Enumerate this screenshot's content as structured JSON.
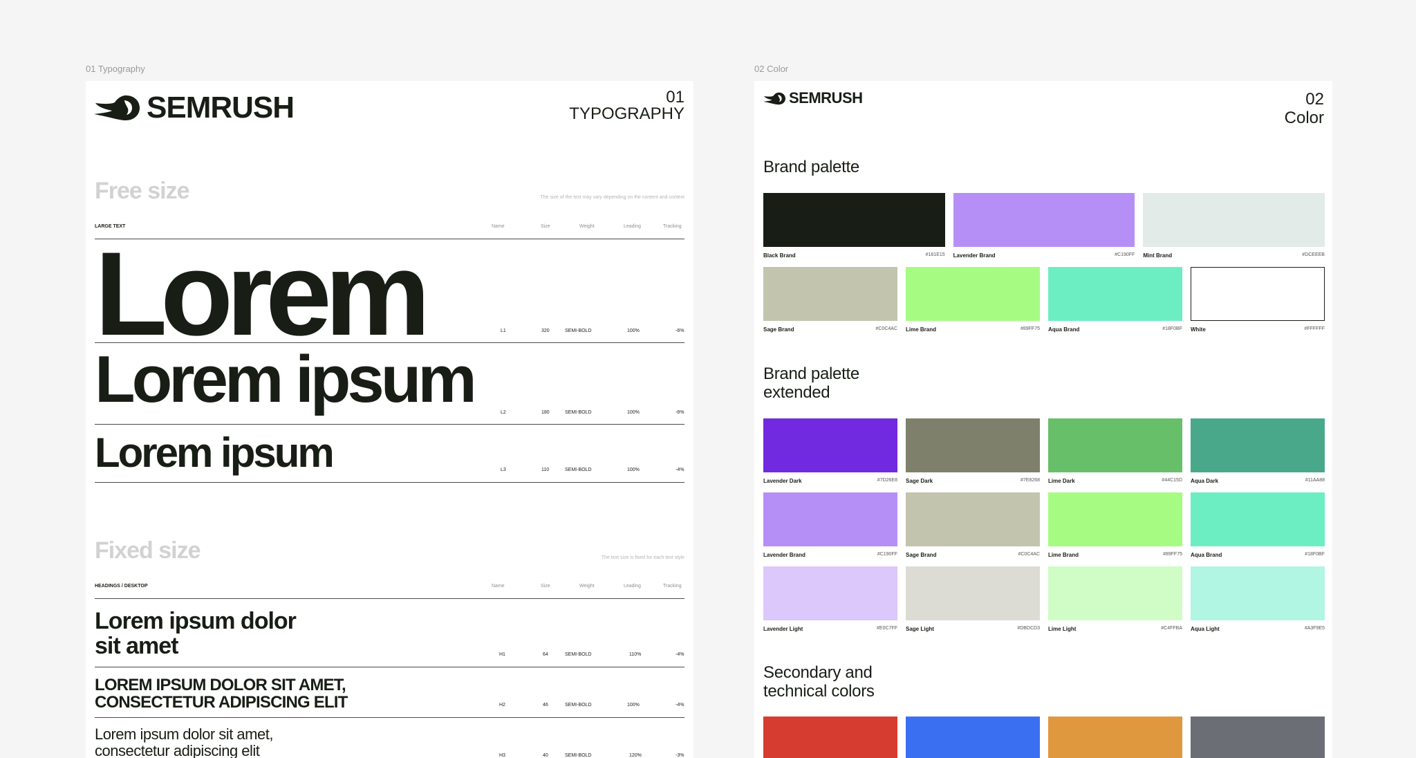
{
  "frames": {
    "typography_label": "01 Typography",
    "color_label": "02 Color"
  },
  "typography": {
    "brand": "SEMRUSH",
    "number": "01",
    "title": "TYPOGRAPHY",
    "columns": {
      "name": "Name",
      "size": "Size",
      "weight": "Weight",
      "leading": "Leading",
      "tracking": "Tracking"
    },
    "free": {
      "title": "Free size",
      "note": "The size of the text may vary depending on the content and context",
      "category": "LARGE TEXT",
      "rows": [
        {
          "sample": "Lorem",
          "name": "L1",
          "size": "320",
          "weight": "SEMI-BOLD",
          "leading": "100%",
          "tracking": "-6%"
        },
        {
          "sample": "Lorem ipsum",
          "name": "L2",
          "size": "180",
          "weight": "SEMI-BOLD",
          "leading": "100%",
          "tracking": "-6%"
        },
        {
          "sample": "Lorem ipsum",
          "name": "L3",
          "size": "110",
          "weight": "SEMI-BOLD",
          "leading": "100%",
          "tracking": "-4%"
        }
      ]
    },
    "fixed": {
      "title": "Fixed size",
      "note": "The text size is fixed for each text style",
      "category": "HEADINGS / DESKTOP",
      "rows": [
        {
          "line1": "Lorem ipsum dolor",
          "line2": "sit amet",
          "name": "H1",
          "size": "64",
          "weight": "SEMI-BOLD",
          "leading": "110%",
          "tracking": "-4%"
        },
        {
          "line1": "LOREM IPSUM DOLOR SIT AMET,",
          "line2": "CONSECTETUR ADIPISCING ELIT",
          "name": "H2",
          "size": "46",
          "weight": "SEMI-BOLD",
          "leading": "100%",
          "tracking": "-4%"
        },
        {
          "line1": "Lorem ipsum dolor sit amet,",
          "line2": "consectetur adipiscing elit",
          "name": "H3",
          "size": "40",
          "weight": "SEMI-BOLD",
          "leading": "120%",
          "tracking": "-3%"
        }
      ]
    }
  },
  "color": {
    "brand": "SEMRUSH",
    "number": "02",
    "title": "Color",
    "brand_palette_title": "Brand palette",
    "brand_palette_row1": [
      {
        "name": "Black Brand",
        "hex": "#181E15"
      },
      {
        "name": "Lavender Brand",
        "hex": "#C190FF"
      },
      {
        "name": "Mint Brand",
        "hex": "#DCEEEB"
      }
    ],
    "brand_palette_row2": [
      {
        "name": "Sage Brand",
        "hex": "#C0C4AC"
      },
      {
        "name": "Lime Brand",
        "hex": "#89FF75"
      },
      {
        "name": "Aqua Brand",
        "hex": "#18F0BF"
      },
      {
        "name": "White",
        "hex": "#FFFFFF"
      }
    ],
    "extended_title_1": "Brand palette",
    "extended_title_2": "extended",
    "extended_rows": [
      [
        {
          "name": "Lavender Dark",
          "hex": "#7D26E8"
        },
        {
          "name": "Sage Dark",
          "hex": "#7E8268"
        },
        {
          "name": "Lime Dark",
          "hex": "#44C15D"
        },
        {
          "name": "Aqua Dark",
          "hex": "#11AA88"
        }
      ],
      [
        {
          "name": "Lavender Brand",
          "hex": "#C190FF"
        },
        {
          "name": "Sage Brand",
          "hex": "#C0C4AC"
        },
        {
          "name": "Lime Brand",
          "hex": "#89FF75"
        },
        {
          "name": "Aqua Brand",
          "hex": "#18F0BF"
        }
      ],
      [
        {
          "name": "Lavender Light",
          "hex": "#E0C7FF"
        },
        {
          "name": "Sage Light",
          "hex": "#DBDCD3"
        },
        {
          "name": "Lime Light",
          "hex": "#C4FFBA"
        },
        {
          "name": "Aqua Light",
          "hex": "#A3F9E5"
        }
      ]
    ],
    "secondary_title_1": "Secondary and",
    "secondary_title_2": "technical colors",
    "secondary_colors": [
      "#d63c2f",
      "#3b6ff2",
      "#e0983f",
      "#6b6e75"
    ],
    "display_colors": {
      "Black Brand": "#181e15",
      "Lavender Brand": "#b68ff6",
      "Mint Brand": "#e2ebe8",
      "Sage Brand": "#c3c4ae",
      "Lime Brand": "#a6fb82",
      "Aqua Brand": "#6deec2",
      "White": "#ffffff",
      "Lavender Dark": "#722ae0",
      "Sage Dark": "#7e806b",
      "Lime Dark": "#68bf6a",
      "Aqua Dark": "#4aa88a",
      "Lavender Light": "#dcc8fb",
      "Sage Light": "#dcdcd5",
      "Lime Light": "#cffdc5",
      "Aqua Light": "#b1f5e3"
    }
  }
}
